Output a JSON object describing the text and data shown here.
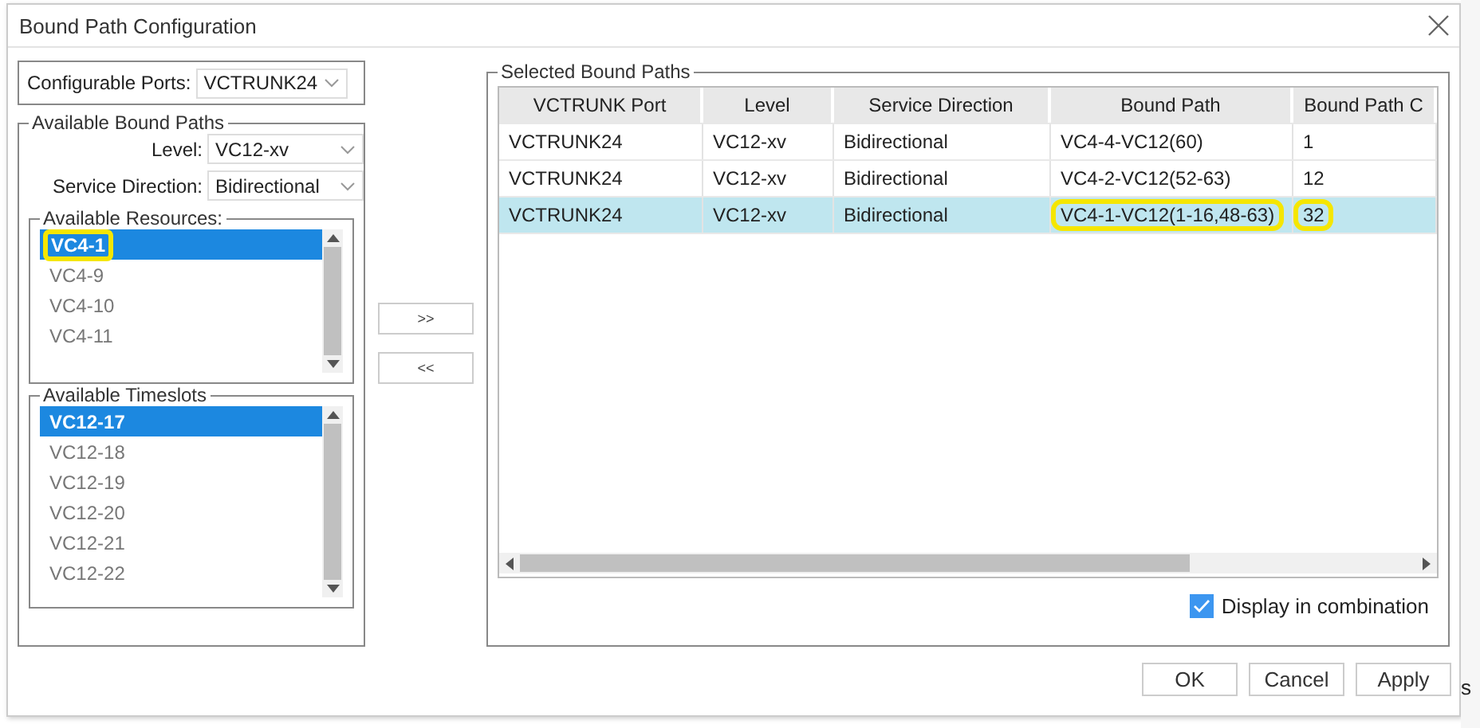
{
  "window": {
    "title": "Bound Path Configuration"
  },
  "configurable_ports": {
    "label": "Configurable Ports:",
    "value": "VCTRUNK24"
  },
  "available_bound_paths": {
    "title": "Available Bound Paths",
    "fields": [
      {
        "label": "Level:",
        "value": "VC12-xv"
      },
      {
        "label": "Service Direction:",
        "value": "Bidirectional"
      }
    ],
    "resources": {
      "title": "Available Resources:",
      "items": [
        {
          "label": "VC4-1",
          "selected": true,
          "highlighted": true
        },
        {
          "label": "VC4-9",
          "selected": false,
          "highlighted": false
        },
        {
          "label": "VC4-10",
          "selected": false,
          "highlighted": false
        },
        {
          "label": "VC4-11",
          "selected": false,
          "highlighted": false
        }
      ]
    },
    "timeslots": {
      "title": "Available Timeslots",
      "items": [
        {
          "label": "VC12-17",
          "selected": true,
          "highlighted": false
        },
        {
          "label": "VC12-18",
          "selected": false,
          "highlighted": false
        },
        {
          "label": "VC12-19",
          "selected": false,
          "highlighted": false
        },
        {
          "label": "VC12-20",
          "selected": false,
          "highlighted": false
        },
        {
          "label": "VC12-21",
          "selected": false,
          "highlighted": false
        },
        {
          "label": "VC12-22",
          "selected": false,
          "highlighted": false
        }
      ]
    }
  },
  "move_buttons": [
    ">>",
    "<<"
  ],
  "selected_bound_paths": {
    "title": "Selected Bound Paths",
    "table": {
      "columns": [
        "VCTRUNK Port",
        "Level",
        "Service Direction",
        "Bound Path",
        "Bound Path C"
      ],
      "rows": [
        {
          "selected": false,
          "cells": [
            {
              "text": "VCTRUNK24",
              "highlighted": false
            },
            {
              "text": "VC12-xv",
              "highlighted": false
            },
            {
              "text": "Bidirectional",
              "highlighted": false
            },
            {
              "text": "VC4-4-VC12(60)",
              "highlighted": false
            },
            {
              "text": "1",
              "highlighted": false
            }
          ]
        },
        {
          "selected": false,
          "cells": [
            {
              "text": "VCTRUNK24",
              "highlighted": false
            },
            {
              "text": "VC12-xv",
              "highlighted": false
            },
            {
              "text": "Bidirectional",
              "highlighted": false
            },
            {
              "text": "VC4-2-VC12(52-63)",
              "highlighted": false
            },
            {
              "text": "12",
              "highlighted": false
            }
          ]
        },
        {
          "selected": true,
          "cells": [
            {
              "text": "VCTRUNK24",
              "highlighted": false
            },
            {
              "text": "VC12-xv",
              "highlighted": false
            },
            {
              "text": "Bidirectional",
              "highlighted": false
            },
            {
              "text": "VC4-1-VC12(1-16,48-63)",
              "highlighted": true
            },
            {
              "text": "32",
              "highlighted": true
            }
          ]
        }
      ]
    },
    "display_in_combination": {
      "label": "Display in combination",
      "checked": true
    }
  },
  "buttons": [
    "OK",
    "Cancel",
    "Apply"
  ],
  "background_text": "s"
}
